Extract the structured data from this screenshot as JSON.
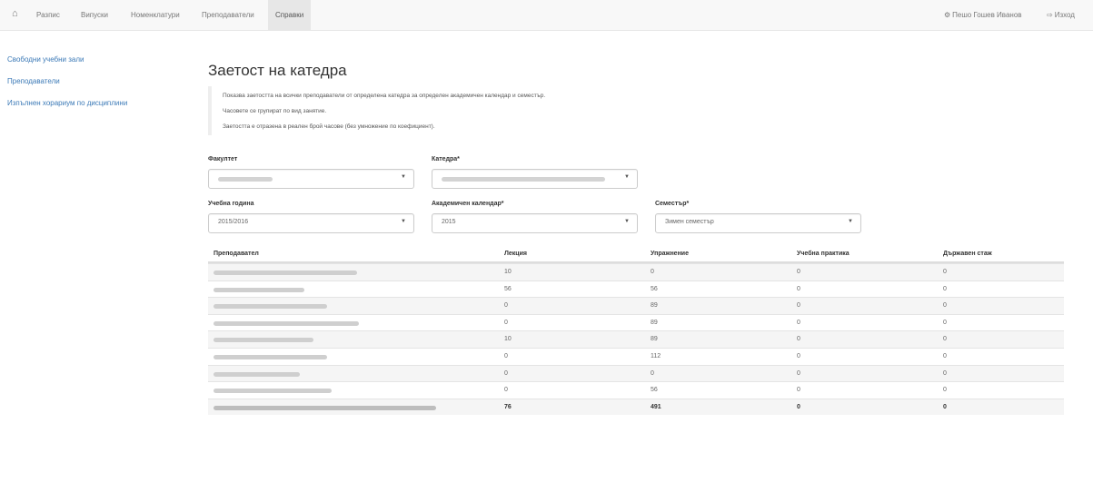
{
  "nav": {
    "items": [
      "Разпис",
      "Випуски",
      "Номенклатури",
      "Преподаватели",
      "Справки"
    ],
    "user": "Пешо Гошев Иванов",
    "logout": "Изход"
  },
  "sidebar": {
    "items": [
      "Свободни учебни зали",
      "Преподаватели",
      "Изпълнен хорариум по дисциплини"
    ]
  },
  "page": {
    "title": "Заетост на катедра",
    "info": [
      "Показва заетостта на всички преподаватели от определена катедра за определен академичен календар и семестър.",
      "Часовете се групират по вид занятие.",
      "Заетостта е отразена в реален брой часове (без умножение по коефициент)."
    ]
  },
  "filters": {
    "faculty": {
      "label": "Факултет",
      "value": ""
    },
    "department": {
      "label": "Катедра*",
      "value": ""
    },
    "year": {
      "label": "Учебна година",
      "value": "2015/2016"
    },
    "calendar": {
      "label": "Академичен календар*",
      "value": "2015"
    },
    "semester": {
      "label": "Семестър*",
      "value": "Зимен семестър"
    }
  },
  "table": {
    "headers": [
      "Преподавател",
      "Лекция",
      "Упражнение",
      "Учебна практика",
      "Държавен стаж"
    ],
    "rows": [
      {
        "lecture": "10",
        "exercise": "0",
        "practice": "0",
        "internship": "0"
      },
      {
        "lecture": "56",
        "exercise": "56",
        "practice": "0",
        "internship": "0"
      },
      {
        "lecture": "0",
        "exercise": "89",
        "practice": "0",
        "internship": "0"
      },
      {
        "lecture": "0",
        "exercise": "89",
        "practice": "0",
        "internship": "0"
      },
      {
        "lecture": "10",
        "exercise": "89",
        "practice": "0",
        "internship": "0"
      },
      {
        "lecture": "0",
        "exercise": "112",
        "practice": "0",
        "internship": "0"
      },
      {
        "lecture": "0",
        "exercise": "0",
        "practice": "0",
        "internship": "0"
      },
      {
        "lecture": "0",
        "exercise": "56",
        "practice": "0",
        "internship": "0"
      }
    ],
    "total": {
      "lecture": "76",
      "exercise": "491",
      "practice": "0",
      "internship": "0"
    }
  },
  "icons": {
    "home": "home-icon",
    "user": "gear-icon",
    "logout": "logout-icon",
    "caret": "chevron-down-icon"
  }
}
